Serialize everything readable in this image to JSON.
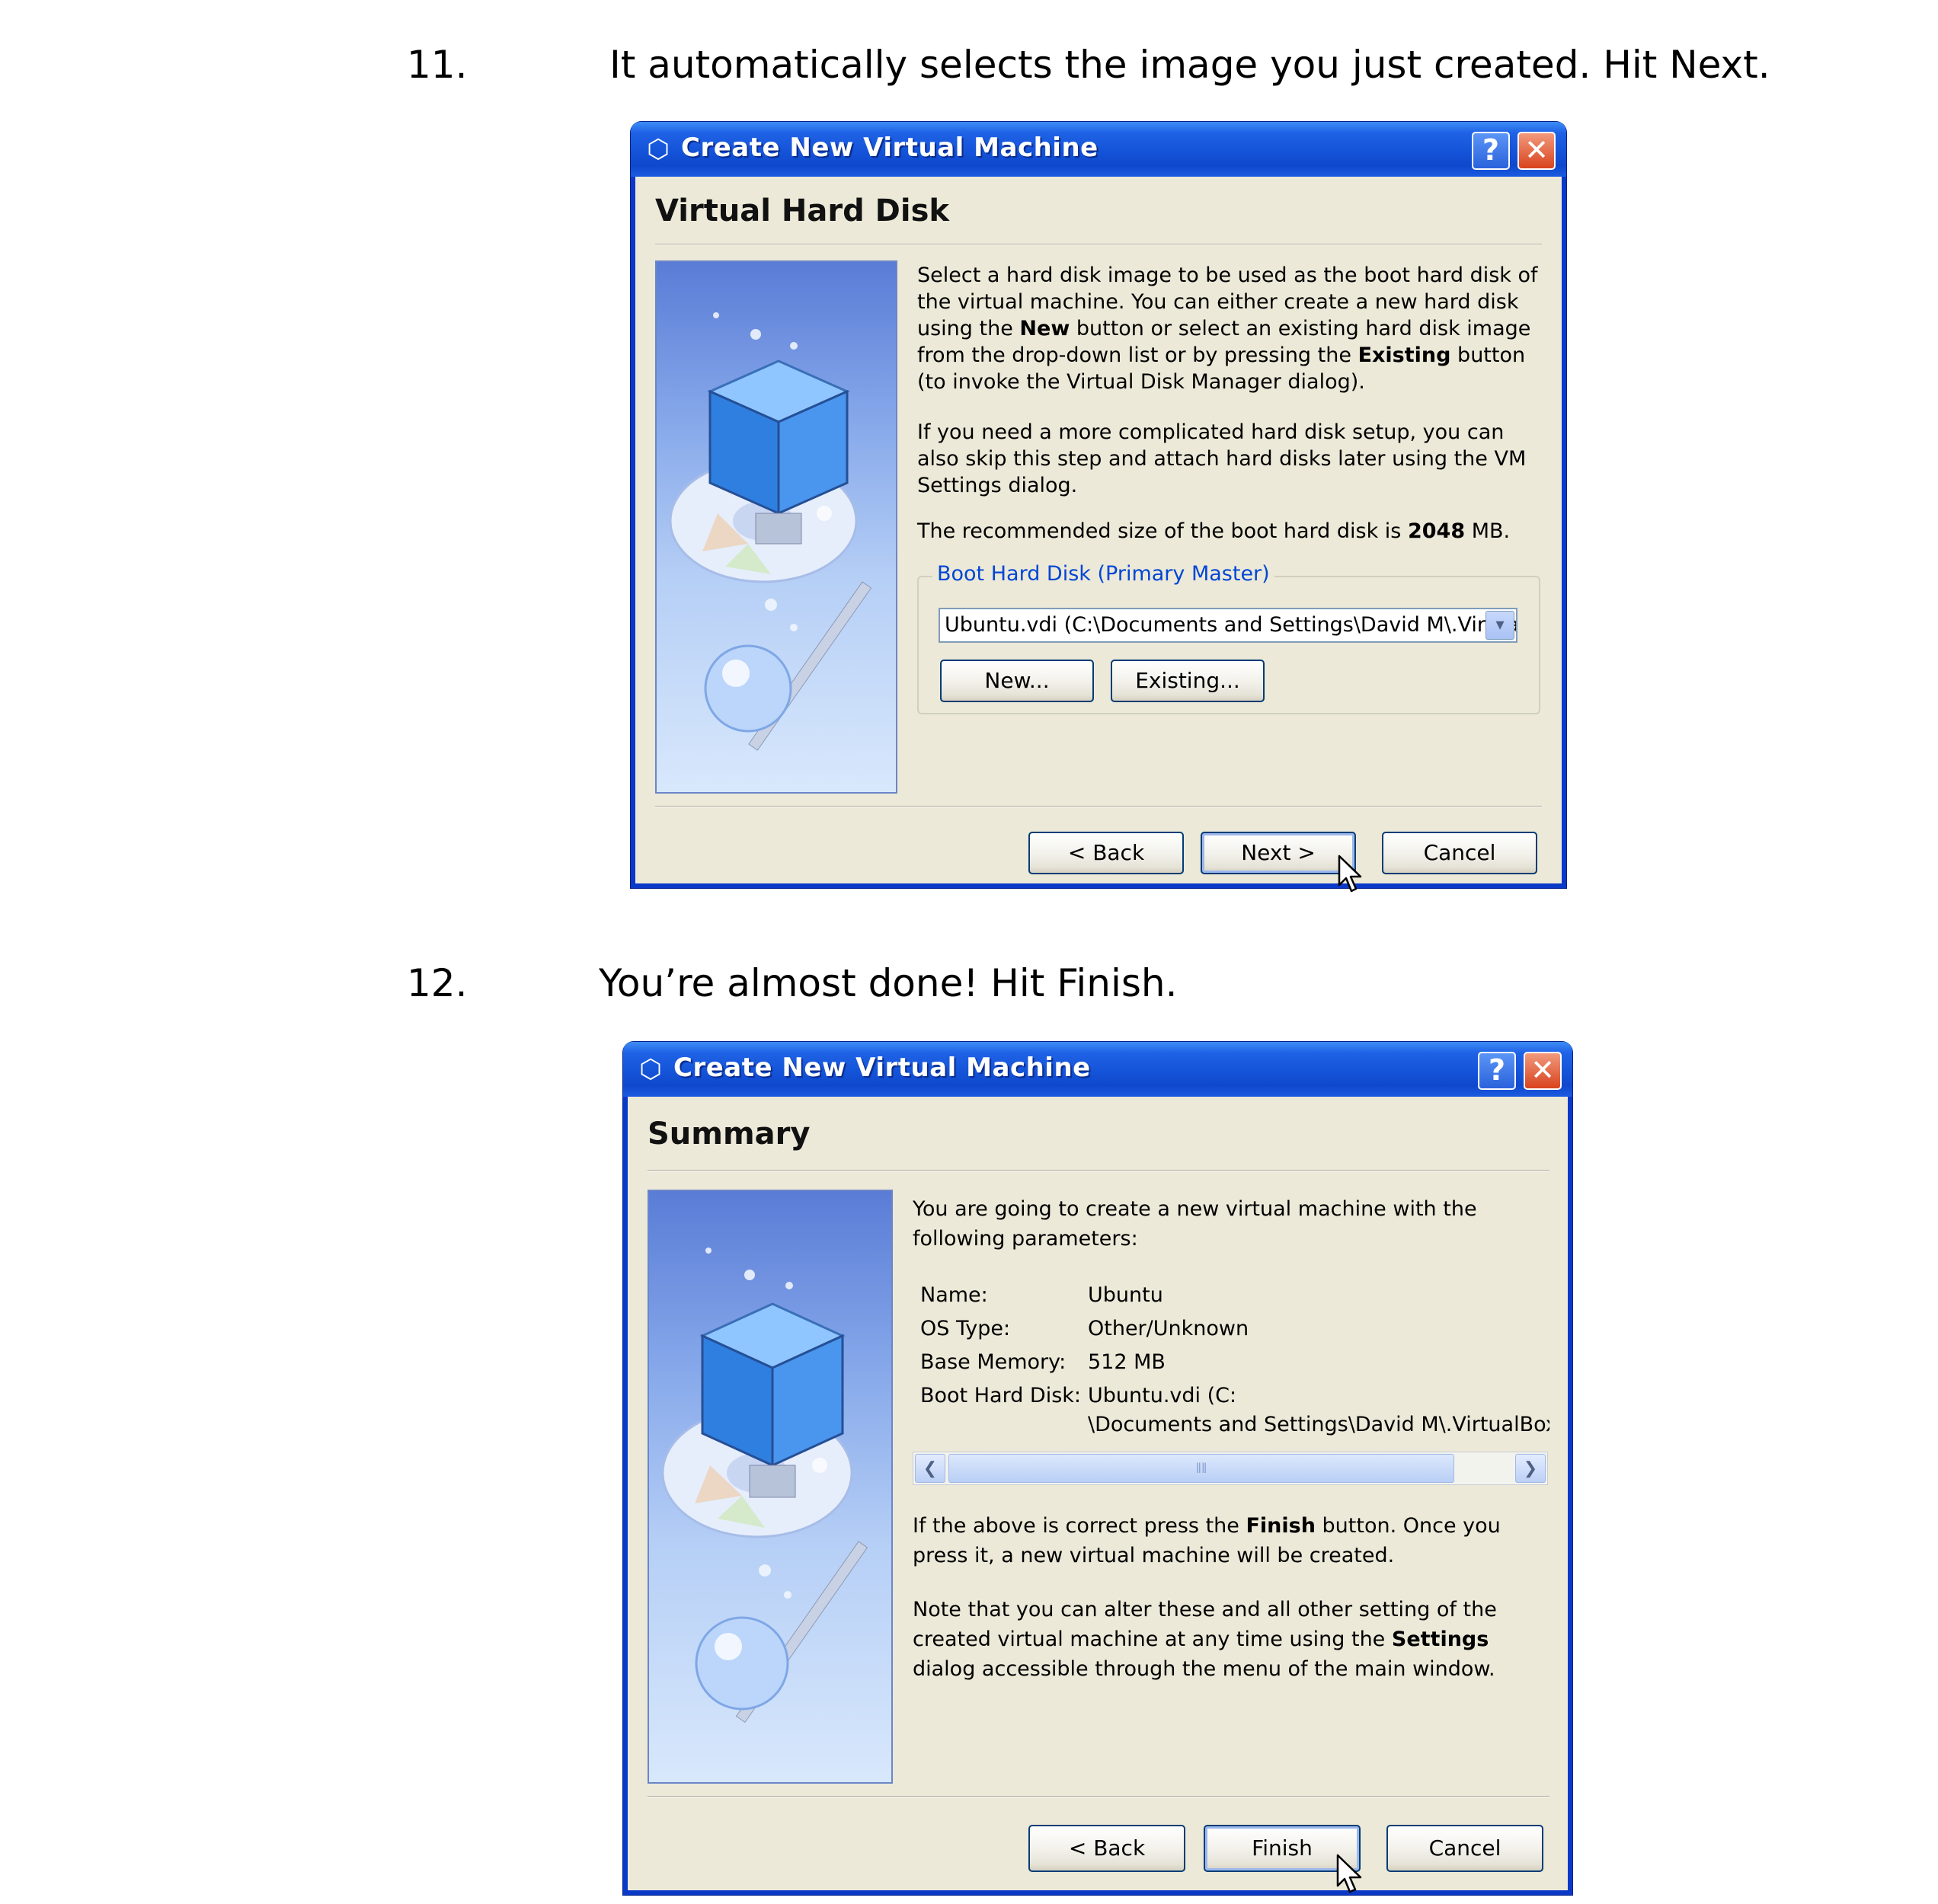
{
  "steps": [
    {
      "number": "11.",
      "instruction": "It automatically selects the image you just created. Hit Next.",
      "dialog": {
        "title": "Create New Virtual Machine",
        "heading": "Virtual Hard Disk",
        "para1_a": "Select a hard disk image to be used as the boot hard disk of the virtual machine. You can either create a new hard disk using the ",
        "para1_b": "New",
        "para1_c": " button or select an existing hard disk image from the drop-down list or by pressing the ",
        "para1_d": "Existing",
        "para1_e": " button (to invoke the Virtual Disk Manager dialog).",
        "para2": "If you need a more complicated hard disk setup, you can also skip this step and attach hard disks later using the VM Settings dialog.",
        "para3_a": "The recommended size of the boot hard disk is ",
        "para3_b": "2048",
        "para3_c": " MB.",
        "group_title": "Boot Hard Disk (Primary Master)",
        "combo_value": "Ubuntu.vdi (C:\\Documents and Settings\\David M\\.VirtualBox",
        "new_label": "New...",
        "existing_label": "Existing...",
        "back_label": "< Back",
        "next_label": "Next >",
        "cancel_label": "Cancel"
      }
    },
    {
      "number": "12.",
      "instruction": "You’re almost done! Hit Finish.",
      "dialog": {
        "title": "Create New Virtual Machine",
        "heading": "Summary",
        "intro": "You are going to create a new virtual machine with the following parameters:",
        "params": [
          {
            "label": "Name:",
            "value": "Ubuntu"
          },
          {
            "label": "OS Type:",
            "value": "Other/Unknown"
          },
          {
            "label": "Base Memory:",
            "value": "512 MB"
          },
          {
            "label": "Boot Hard Disk:",
            "value": "Ubuntu.vdi (C:"
          }
        ],
        "disk_continuation": "\\Documents and Settings\\David M\\.VirtualBox",
        "para_finish_a": "If the above is correct press the ",
        "para_finish_b": "Finish",
        "para_finish_c": " button. Once you press it, a new virtual machine will be created.",
        "para_note_a": "Note that you can alter these and all other setting of the created virtual machine at any time using the ",
        "para_note_b": "Settings",
        "para_note_c": " dialog accessible through the menu of the main window.",
        "back_label": "< Back",
        "finish_label": "Finish",
        "cancel_label": "Cancel"
      }
    }
  ],
  "colors": {
    "titlebar": "#1453d8",
    "window_bg": "#ece9d8",
    "group_title": "#0046d5"
  },
  "icons": {
    "title": "virtualbox-cube-icon",
    "help": "question-mark-icon",
    "close": "close-x-icon",
    "combo": "chevron-down-icon",
    "cursor": "mouse-pointer-icon"
  }
}
